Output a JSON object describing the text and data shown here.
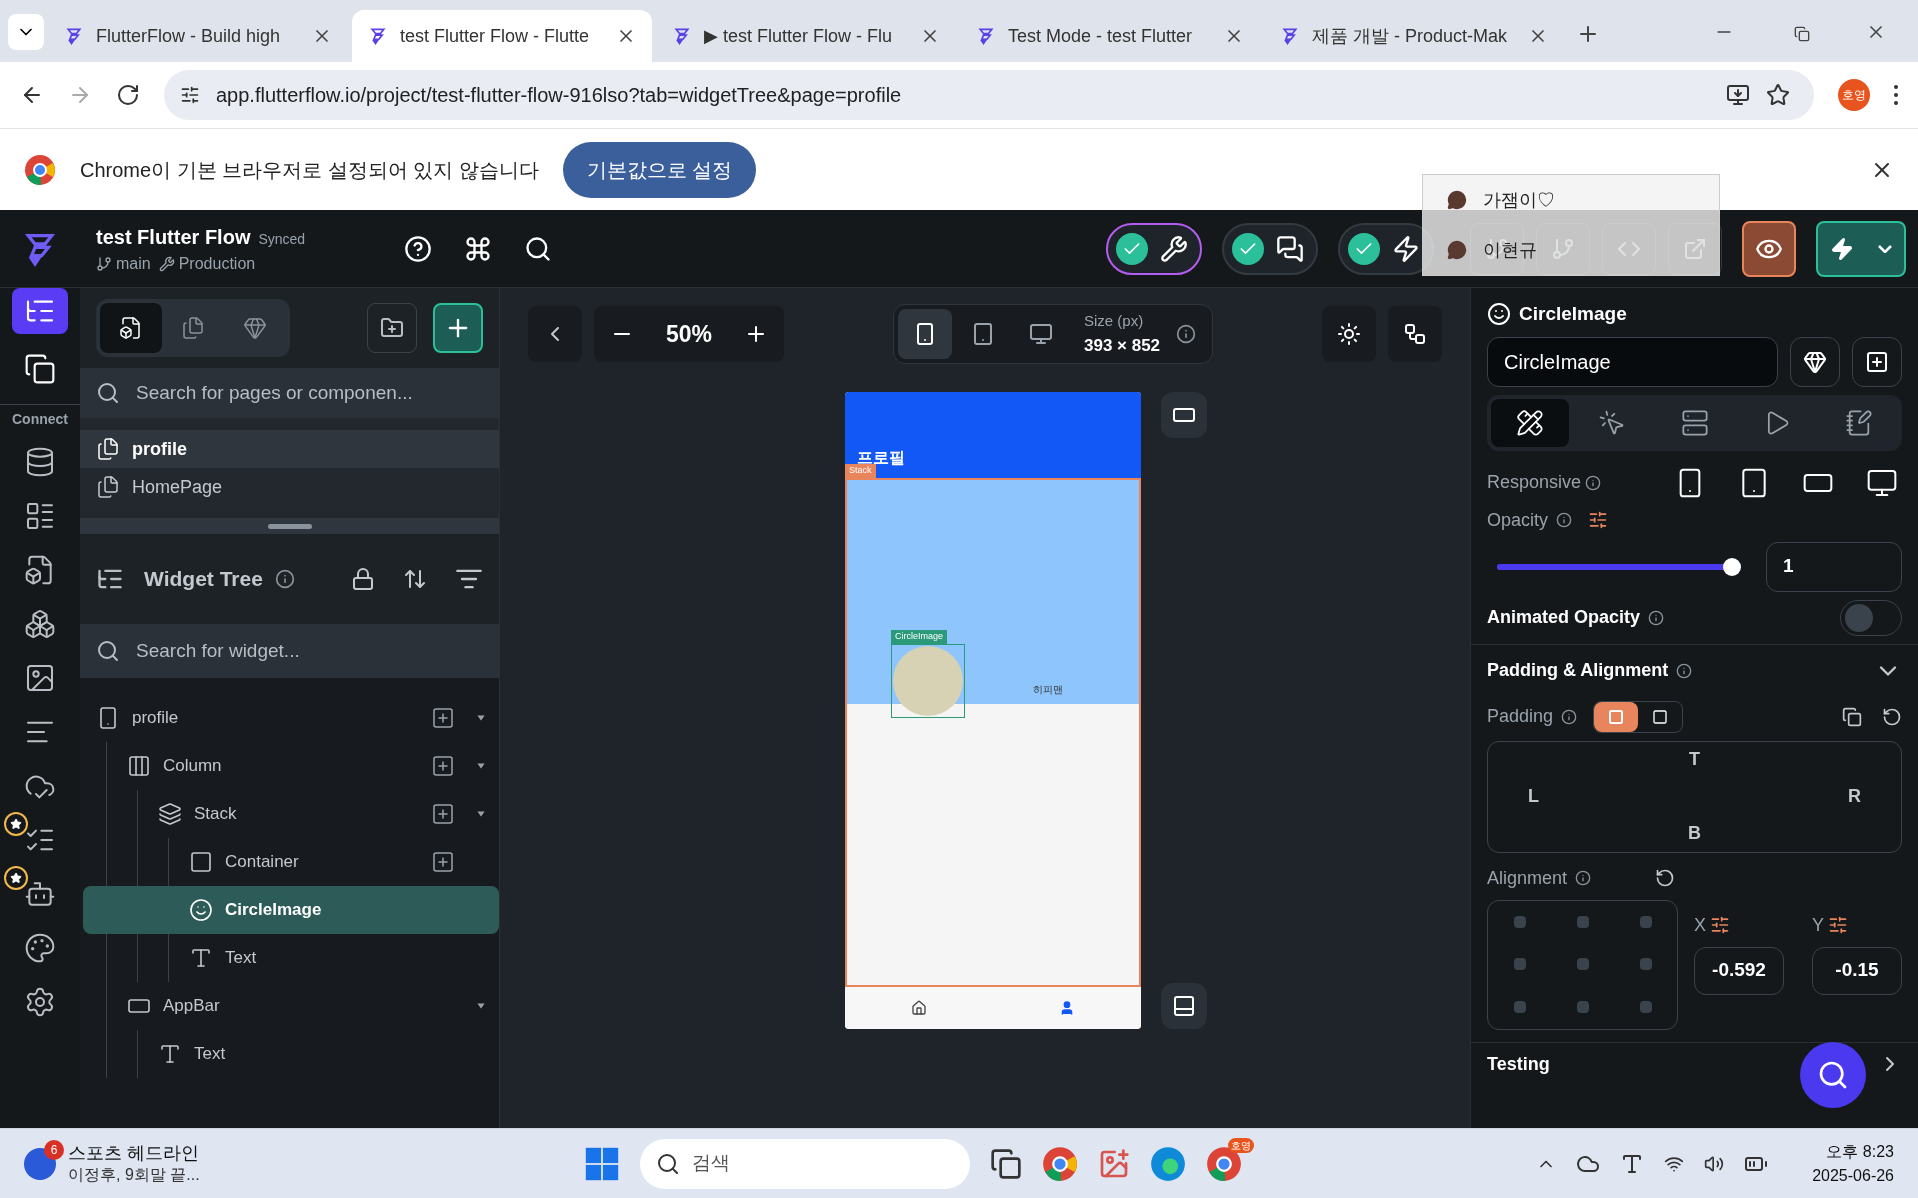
{
  "browser": {
    "tabs": [
      {
        "title": "FlutterFlow - Build high",
        "selected": false
      },
      {
        "title": "test Flutter Flow - Flutte",
        "selected": true
      },
      {
        "title": "▶ test Flutter Flow - Flu",
        "selected": false
      },
      {
        "title": "Test Mode - test Flutter",
        "selected": false
      },
      {
        "title": "제품 개발 - Product-Mak",
        "selected": false
      }
    ],
    "url": "app.flutterflow.io/project/test-flutter-flow-916lso?tab=widgetTree&page=profile",
    "profile": "호영"
  },
  "infobar": {
    "message": "Chrome이 기본 브라우저로 설정되어 있지 않습니다",
    "button": "기본값으로 설정"
  },
  "app": {
    "project_title": "test Flutter Flow",
    "status": "Synced",
    "branch": "main",
    "environment": "Production"
  },
  "mode_toggles": [
    {
      "kind": "design",
      "checked": true
    },
    {
      "kind": "chat",
      "checked": true
    },
    {
      "kind": "logic",
      "checked": true
    }
  ],
  "comment_popup": {
    "items": [
      "가잼이♡",
      "이현규"
    ]
  },
  "rail": {
    "top_items": [
      {
        "kind": "widget-tree",
        "selected": true
      },
      {
        "kind": "storyboard",
        "selected": false
      }
    ],
    "label": "Connect",
    "items": [
      {
        "kind": "database",
        "starred": false
      },
      {
        "kind": "list",
        "starred": false
      },
      {
        "kind": "file",
        "starred": false
      },
      {
        "kind": "components",
        "starred": false
      },
      {
        "kind": "media",
        "starred": false
      },
      {
        "kind": "outline",
        "starred": false
      },
      {
        "kind": "cloud",
        "starred": false
      },
      {
        "kind": "test",
        "starred": true
      },
      {
        "kind": "agent",
        "starred": true
      },
      {
        "kind": "theme",
        "starred": false
      },
      {
        "kind": "settings",
        "starred": false
      }
    ]
  },
  "pages_panel": {
    "tabs": [
      {
        "kind": "pages",
        "selected": true
      },
      {
        "kind": "components",
        "selected": false
      },
      {
        "kind": "library",
        "selected": false
      }
    ],
    "search_placeholder": "Search for pages or componen...",
    "pages": [
      {
        "name": "profile",
        "selected": true
      },
      {
        "name": "HomePage",
        "selected": false
      }
    ]
  },
  "widget_tree": {
    "title": "Widget Tree",
    "search_placeholder": "Search for widget...",
    "nodes": [
      {
        "name": "profile",
        "kind": "page",
        "can_add": true,
        "expanded": true,
        "selected": false,
        "children": [
          {
            "name": "Column",
            "kind": "column",
            "can_add": true,
            "expanded": true,
            "selected": false,
            "children": [
              {
                "name": "Stack",
                "kind": "stack",
                "can_add": true,
                "expanded": true,
                "selected": false,
                "children": [
                  {
                    "name": "Container",
                    "kind": "container",
                    "can_add": true,
                    "selected": false
                  },
                  {
                    "name": "CircleImage",
                    "kind": "image",
                    "can_add": false,
                    "selected": true
                  },
                  {
                    "name": "Text",
                    "kind": "text",
                    "can_add": false,
                    "selected": false
                  }
                ]
              }
            ]
          },
          {
            "name": "AppBar",
            "kind": "appbar",
            "can_add": false,
            "expanded": true,
            "selected": false,
            "children": [
              {
                "name": "Text",
                "kind": "text",
                "can_add": false,
                "selected": false
              }
            ]
          }
        ]
      }
    ]
  },
  "canvas": {
    "zoom": "50%",
    "devices": [
      {
        "kind": "phone",
        "selected": true
      },
      {
        "kind": "tablet",
        "selected": false
      },
      {
        "kind": "desktop",
        "selected": false
      }
    ],
    "size_label": "Size (px)",
    "size": "393 × 852",
    "phone": {
      "appbar_title": "프로필",
      "stack_tag": "Stack",
      "image_tag": "CircleImage",
      "text": "히피맨",
      "nav": [
        {
          "kind": "home",
          "selected": false
        },
        {
          "kind": "person",
          "selected": true
        }
      ]
    }
  },
  "properties": {
    "widget_type": "CircleImage",
    "name_value": "CircleImage",
    "tabs": [
      {
        "kind": "style",
        "selected": true
      },
      {
        "kind": "actions",
        "selected": false
      },
      {
        "kind": "backend",
        "selected": false
      },
      {
        "kind": "play",
        "selected": false
      },
      {
        "kind": "notes",
        "selected": false
      }
    ],
    "responsive_label": "Responsive",
    "opacity_label": "Opacity",
    "opacity": {
      "level": 1,
      "value": "1"
    },
    "animated_opacity": {
      "label": "Animated Opacity",
      "on": false
    },
    "section": {
      "title": "Padding & Alignment",
      "expanded": true
    },
    "padding_label": "Padding",
    "padding_modes": [
      {
        "kind": "linked",
        "selected": true
      },
      {
        "kind": "single",
        "selected": false
      }
    ],
    "padding_sides": {
      "top": "T",
      "left": "L",
      "right": "R",
      "bottom": "B"
    },
    "alignment_label": "Alignment",
    "x_label": "X",
    "y_label": "Y",
    "x_value": "-0.592",
    "y_value": "-0.15",
    "testing": "Testing"
  },
  "taskbar": {
    "news_badge": "6",
    "news_title": "스포츠 헤드라인",
    "news_subtitle": "이정후, 9회말 끝...",
    "search_placeholder": "검색",
    "chrome_badge": "호영",
    "time": "오후 8:23",
    "date": "2025-06-26"
  }
}
